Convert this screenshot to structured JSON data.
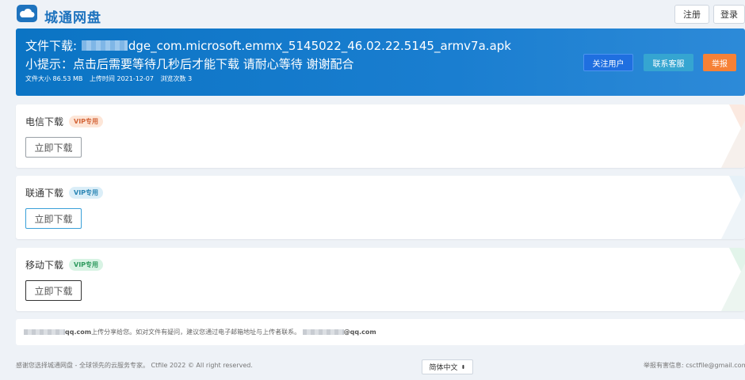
{
  "header": {
    "brand": "城通网盘",
    "register_label": "注册",
    "login_label": "登录"
  },
  "banner": {
    "title_prefix": "文件下载: ",
    "title_suffix": "dge_com.microsoft.emmx_5145022_46.02.22.5145_armv7a.apk",
    "tip": "小提示：点击后需要等待几秒后才能下载 请耐心等待 谢谢配合",
    "size": "文件大小 86.53 MB",
    "upload_time": "上传时间 2021-12-07",
    "views": "浏览次数 3",
    "follow_label": "关注用户",
    "contact_label": "联系客服",
    "report_label": "举报"
  },
  "downloads": [
    {
      "label": "电信下载",
      "badge": "VIP专用",
      "button": "立即下载"
    },
    {
      "label": "联通下载",
      "badge": "VIP专用",
      "button": "立即下载"
    },
    {
      "label": "移动下载",
      "badge": "VIP专用",
      "button": "立即下载"
    }
  ],
  "share": {
    "sender_suffix": "qq.com",
    "message": " 上传分享给您。如对文件有疑问，建议您通过电子邮箱地址与上传者联系。",
    "contact_suffix": "@qq.com"
  },
  "footer": {
    "left": "感谢您选择城通网盘 - 全球领先的云服务专家。 Ctfile 2022 © All right reserved.",
    "language": "简体中文",
    "right": "举报有害信息: csctfile@gmail.com"
  },
  "colors": {
    "brand": "#1e73be",
    "banner": "#0b74c4",
    "follow": "#1f6fe0",
    "contact": "#35a5d1",
    "report": "#f68136"
  }
}
